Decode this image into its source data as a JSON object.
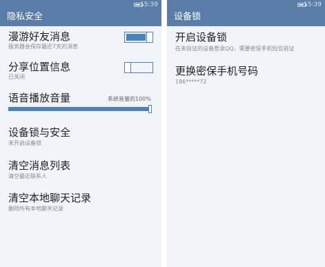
{
  "status": {
    "time": "15:39"
  },
  "left": {
    "title": "隐私安全",
    "items": [
      {
        "label": "漫游好友消息",
        "sub": "服务器会保存最近7天的消息",
        "toggle_on": true
      },
      {
        "label": "分享位置信息",
        "sub": "已关闭",
        "toggle_on": false
      },
      {
        "label": "语音播放音量",
        "value": "系统音量的100%",
        "level": 1.0
      },
      {
        "label": "设备锁与安全",
        "sub": "未开启设备锁"
      },
      {
        "label": "清空消息列表",
        "sub": "清空最近联系人"
      },
      {
        "label": "清空本地聊天记录",
        "sub": "删除所有本地聊天记录"
      }
    ]
  },
  "right": {
    "title": "设备锁",
    "items": [
      {
        "label": "开启设备锁",
        "sub": "在未验证的设备登录QQ，需要密保手机短信验证"
      },
      {
        "label": "更换密保手机号码",
        "sub": "186*****72"
      }
    ]
  }
}
